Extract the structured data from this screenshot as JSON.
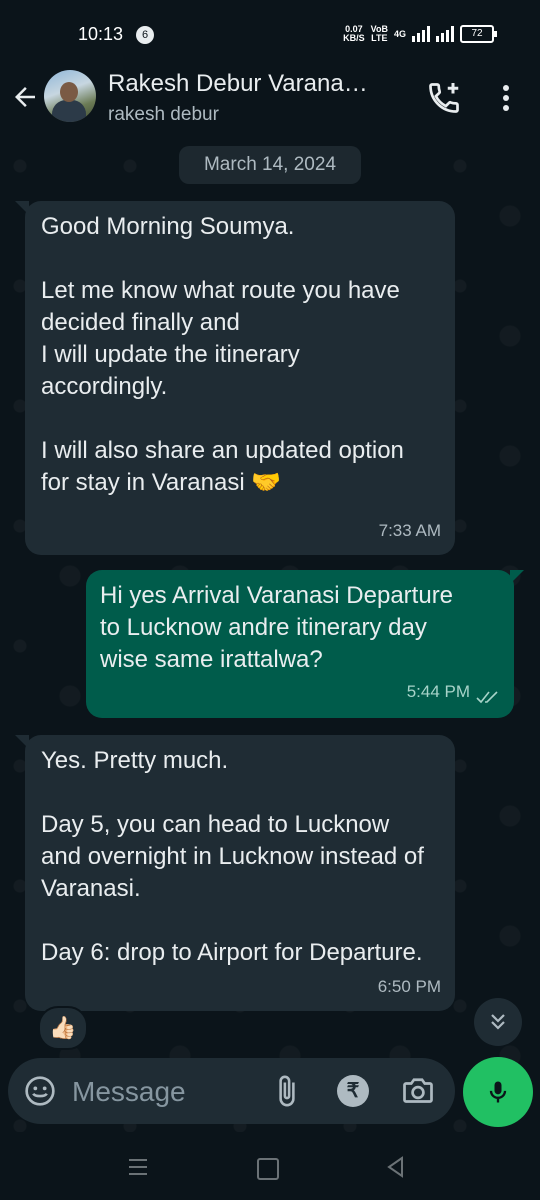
{
  "status_bar": {
    "time": "10:13",
    "notification_count": "6",
    "net_speed_value": "0.07",
    "net_speed_unit": "KB/S",
    "volte_top": "VoB",
    "volte_bottom": "LTE",
    "network": "4G",
    "battery": "72"
  },
  "header": {
    "contact_name": "Rakesh Debur Varana…",
    "contact_subtitle": "rakesh debur"
  },
  "chat": {
    "date_chip": "March 14, 2024",
    "messages": [
      {
        "direction": "in",
        "text": "Good Morning Soumya.\n\nLet me know what route you have decided finally and\nI will update the itinerary accordingly.\n\nI will also share an updated option for stay in Varanasi 🤝",
        "time": "7:33 AM"
      },
      {
        "direction": "out",
        "text": "Hi yes Arrival Varanasi Departure to Lucknow andre itinerary day wise same irattalwa?",
        "time": "5:44 PM"
      },
      {
        "direction": "in",
        "text": "Yes. Pretty much.\n\nDay 5, you can head to Lucknow and overnight in Lucknow instead of Varanasi.\n\nDay 6: drop to Airport for Departure.",
        "time": "6:50 PM"
      }
    ],
    "reaction": "👍🏻"
  },
  "composer": {
    "placeholder": "Message",
    "rupee_symbol": "₹"
  },
  "colors": {
    "background": "#0b141a",
    "incoming_bubble": "#1f2c34",
    "outgoing_bubble": "#005c4b",
    "accent_green": "#21c063"
  },
  "icons": [
    "back-arrow-icon",
    "add-call-icon",
    "more-options-icon",
    "emoji-icon",
    "attach-icon",
    "rupee-icon",
    "camera-icon",
    "mic-icon",
    "scroll-down-icon",
    "double-check-icon"
  ]
}
